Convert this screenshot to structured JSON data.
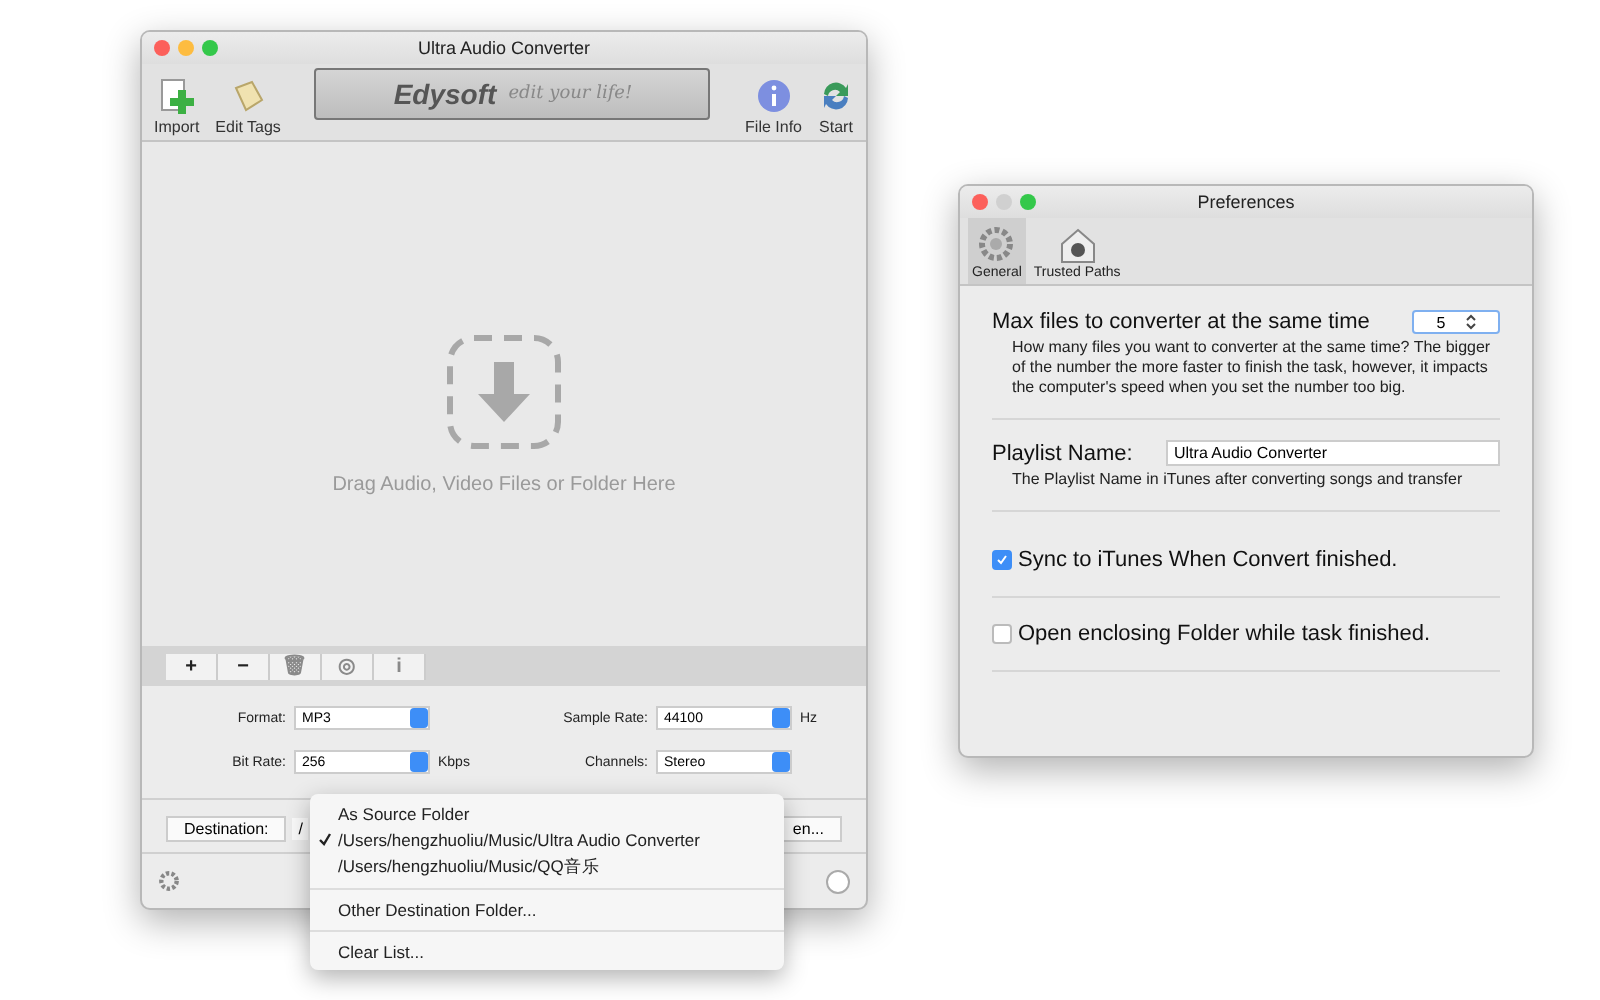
{
  "main_window": {
    "title": "Ultra Audio Converter",
    "toolbar": [
      {
        "label": "Import",
        "kind": "import"
      },
      {
        "label": "Edit Tags",
        "kind": "tags"
      },
      {
        "label": "File Info",
        "kind": "info"
      },
      {
        "label": "Start",
        "kind": "start"
      }
    ],
    "banner": {
      "brand": "Edysoft",
      "slogan": "edit your life!"
    },
    "drop_area": {
      "text": "Drag Audio, Video Files or Folder Here"
    },
    "list_buttons": [
      {
        "label": "+",
        "disabled": false
      },
      {
        "label": "−",
        "disabled": false
      },
      {
        "label": "🗑",
        "disabled": true
      },
      {
        "label": "◎",
        "disabled": true
      },
      {
        "label": "i",
        "disabled": true
      }
    ],
    "settings": [
      {
        "label": "Format:",
        "value": "MP3"
      },
      {
        "label": "Sample Rate:",
        "value": "44100",
        "unit": "Hz"
      },
      {
        "label": "Bit Rate:",
        "value": "256",
        "unit": "Kbps"
      },
      {
        "label": "Channels:",
        "value": "Stereo"
      }
    ],
    "destination": {
      "button": "Destination:",
      "value": "/",
      "open_button": "en..."
    }
  },
  "destination_menu": {
    "items": [
      {
        "label": "As Source Folder",
        "checked": false,
        "separator_before": false
      },
      {
        "label": "/Users/hengzhuoliu/Music/Ultra Audio Converter",
        "checked": true,
        "separator_before": false
      },
      {
        "label": "/Users/hengzhuoliu/Music/QQ音乐",
        "checked": false,
        "separator_before": false
      },
      {
        "label": "Other Destination Folder...",
        "checked": false,
        "separator_before": true
      },
      {
        "label": "Clear List...",
        "checked": false,
        "separator_before": true
      }
    ]
  },
  "preferences": {
    "title": "Preferences",
    "tabs": [
      {
        "label": "General",
        "selected": true,
        "kind": "gear"
      },
      {
        "label": "Trusted Paths",
        "selected": false,
        "kind": "house"
      }
    ],
    "max_files": {
      "label": "Max files to converter at the same time",
      "value": "5",
      "help": "How many files you want to converter at the same time? The bigger of the number the more faster to finish the task, however, it impacts the computer's speed when you set the number too big."
    },
    "playlist": {
      "label": "Playlist Name:",
      "value": "Ultra Audio Converter",
      "help": "The Playlist Name in iTunes after converting songs and transfer"
    },
    "options": [
      {
        "label": "Sync to iTunes When Convert finished.",
        "checked": true
      },
      {
        "label": "Open enclosing Folder while task finished.",
        "checked": false
      }
    ]
  }
}
